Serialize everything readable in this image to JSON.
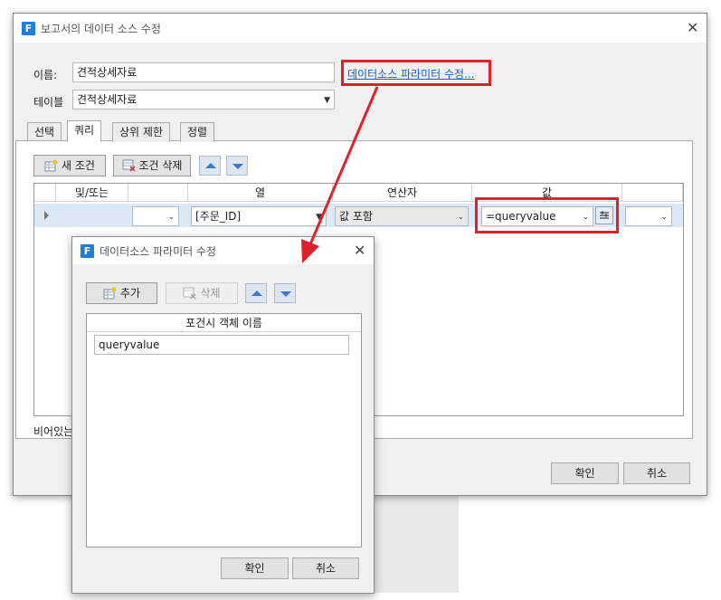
{
  "main_dialog": {
    "title": "보고서의 데이터 소스 수정",
    "name_label": "이름:",
    "name_value": "견적상세자료",
    "param_link": "데이터소스 파라미터 수정...",
    "table_label": "테이블",
    "table_value": "견적상세자료",
    "tabs": [
      {
        "label": "선택"
      },
      {
        "label": "쿼리"
      },
      {
        "label": "상위 제한"
      },
      {
        "label": "정렬"
      }
    ],
    "new_condition": "새 조건",
    "delete_condition": "조건 삭제",
    "grid_headers": [
      "및/또는",
      "열",
      "연산자",
      "값"
    ],
    "row": {
      "andor": "",
      "column": "[주문_ID]",
      "operator": "값 포함",
      "value": "=queryvalue",
      "extra": ""
    },
    "footer_text": "비어있는",
    "ok": "확인",
    "cancel": "취소"
  },
  "sub_dialog": {
    "title": "데이터소스 파라미터 수정",
    "add": "추가",
    "delete": "삭제",
    "grid_header": "포건시 객체 이름",
    "param_value": "queryvalue",
    "ok": "확인",
    "cancel": "취소"
  },
  "colors": {
    "highlight_red": "#e0202a",
    "link_blue": "#1a5fd0",
    "app_icon_blue": "#1f7fd8"
  }
}
